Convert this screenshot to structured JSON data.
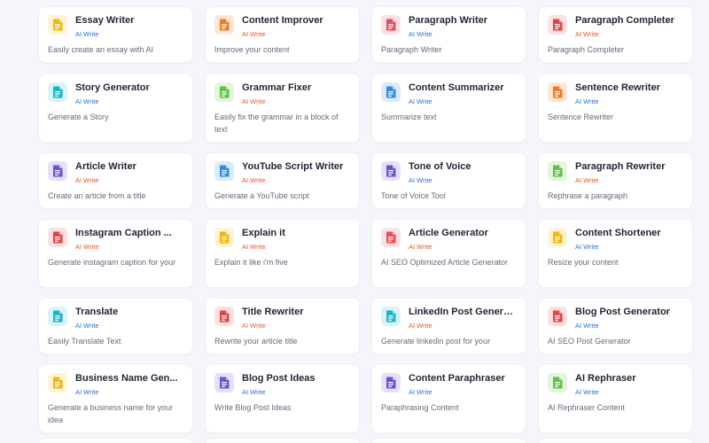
{
  "tools": [
    {
      "title": "Essay Writer",
      "badge": "AI Write",
      "badge_color": "#2f6fd8",
      "desc": "Easily create an essay with AI",
      "icon": "document-icon",
      "icon_color": "#f2b70a",
      "icon_bg": "#fdf3d6"
    },
    {
      "title": "Content Improver",
      "badge": "AI Write",
      "badge_color": "#e4572e",
      "desc": "Improve your content",
      "icon": "document-icon",
      "icon_color": "#f07b22",
      "icon_bg": "#fde6d6"
    },
    {
      "title": "Paragraph Writer",
      "badge": "AI Write",
      "badge_color": "#2f6fd8",
      "desc": "Paragraph Writer",
      "icon": "document-icon",
      "icon_color": "#ef4a5a",
      "icon_bg": "#fde0e3"
    },
    {
      "title": "Paragraph Completer",
      "badge": "AI Write",
      "badge_color": "#e4572e",
      "desc": "Paragraph Completer",
      "icon": "document-icon",
      "icon_color": "#e04444",
      "icon_bg": "#fde0e0"
    },
    {
      "title": "Story Generator",
      "badge": "AI Write",
      "badge_color": "#2f6fd8",
      "desc": "Generate a Story",
      "icon": "document-icon",
      "icon_color": "#17b6c8",
      "icon_bg": "#d9f3f6"
    },
    {
      "title": "Grammar Fixer",
      "badge": "AI Write",
      "badge_color": "#e4572e",
      "desc": "Easily fix the grammar in a block of text",
      "icon": "document-icon",
      "icon_color": "#5fc04a",
      "icon_bg": "#e3f5dc"
    },
    {
      "title": "Content Summarizer",
      "badge": "AI Write",
      "badge_color": "#2f6fd8",
      "desc": "Summarize text",
      "icon": "document-icon",
      "icon_color": "#2f8de4",
      "icon_bg": "#dcebfb"
    },
    {
      "title": "Sentence Rewriter",
      "badge": "AI Write",
      "badge_color": "#2f6fd8",
      "desc": "Sentence Rewriter",
      "icon": "document-icon",
      "icon_color": "#f07b22",
      "icon_bg": "#fde6d6"
    },
    {
      "title": "Article Writer",
      "badge": "AI Write",
      "badge_color": "#e4572e",
      "desc": "Create an article from a title",
      "icon": "document-icon",
      "icon_color": "#6c52d9",
      "icon_bg": "#e6e0fa"
    },
    {
      "title": "YouTube Script Writer",
      "badge": "AI Write",
      "badge_color": "#e4572e",
      "desc": "Generate a YouTube script",
      "icon": "document-icon",
      "icon_color": "#2f8de4",
      "icon_bg": "#dcebfb"
    },
    {
      "title": "Tone of Voice",
      "badge": "AI Write",
      "badge_color": "#2f6fd8",
      "desc": "Tone of Voice Tool",
      "icon": "document-icon",
      "icon_color": "#6c52d9",
      "icon_bg": "#e6e0fa"
    },
    {
      "title": "Paragraph Rewriter",
      "badge": "AI Write",
      "badge_color": "#e4572e",
      "desc": "Rephrase a paragraph",
      "icon": "document-icon",
      "icon_color": "#5fc04a",
      "icon_bg": "#e3f5dc"
    },
    {
      "title": "Instagram Caption ...",
      "badge": "AI Write",
      "badge_color": "#e4572e",
      "desc": "Generate instagram caption for your",
      "icon": "document-icon",
      "icon_color": "#e04444",
      "icon_bg": "#fde0e0"
    },
    {
      "title": "Explain it",
      "badge": "AI Write",
      "badge_color": "#e4572e",
      "desc": "Explain it like i'm five",
      "icon": "document-icon",
      "icon_color": "#f2b70a",
      "icon_bg": "#fdf3d6"
    },
    {
      "title": "Article Generator",
      "badge": "AI Write",
      "badge_color": "#e4572e",
      "desc": "AI SEO Optimized Article Generator",
      "icon": "document-icon",
      "icon_color": "#ef4a5a",
      "icon_bg": "#fde0e3"
    },
    {
      "title": "Content Shortener",
      "badge": "AI Write",
      "badge_color": "#2f6fd8",
      "desc": "Resize your content",
      "icon": "document-icon",
      "icon_color": "#f2b70a",
      "icon_bg": "#fdf3d6"
    },
    {
      "title": "Translate",
      "badge": "AI Write",
      "badge_color": "#2f6fd8",
      "desc": "Easily Translate Text",
      "icon": "document-icon",
      "icon_color": "#17b6c8",
      "icon_bg": "#d9f3f6"
    },
    {
      "title": "Title Rewriter",
      "badge": "AI Write",
      "badge_color": "#e4572e",
      "desc": "Rewrite your article title",
      "icon": "document-icon",
      "icon_color": "#e04444",
      "icon_bg": "#fde0e0"
    },
    {
      "title": "LinkedIn Post Genera...",
      "badge": "AI Write",
      "badge_color": "#e4572e",
      "desc": "Generate linkedin post for your",
      "icon": "document-icon",
      "icon_color": "#17b6c8",
      "icon_bg": "#d9f3f6"
    },
    {
      "title": "Blog Post Generator",
      "badge": "AI Write",
      "badge_color": "#2f6fd8",
      "desc": "AI SEO Post Generator",
      "icon": "document-icon",
      "icon_color": "#e04444",
      "icon_bg": "#fde0e0"
    },
    {
      "title": "Business Name Gen...",
      "badge": "AI Write",
      "badge_color": "#2f6fd8",
      "desc": "Generate a business name for your idea",
      "icon": "document-icon",
      "icon_color": "#f2b70a",
      "icon_bg": "#fdf3d6"
    },
    {
      "title": "Blog Post Ideas",
      "badge": "AI Write",
      "badge_color": "#2f6fd8",
      "desc": "Write Blog Post Ideas",
      "icon": "document-icon",
      "icon_color": "#6c52d9",
      "icon_bg": "#e6e0fa"
    },
    {
      "title": "Content Paraphraser",
      "badge": "AI Write",
      "badge_color": "#2f6fd8",
      "desc": "Paraphrasing Content",
      "icon": "document-icon",
      "icon_color": "#6c52d9",
      "icon_bg": "#e6e0fa"
    },
    {
      "title": "AI Rephraser",
      "badge": "AI Write",
      "badge_color": "#2f6fd8",
      "desc": "AI Rephraser Content",
      "icon": "document-icon",
      "icon_color": "#5fc04a",
      "icon_bg": "#e3f5dc"
    }
  ]
}
